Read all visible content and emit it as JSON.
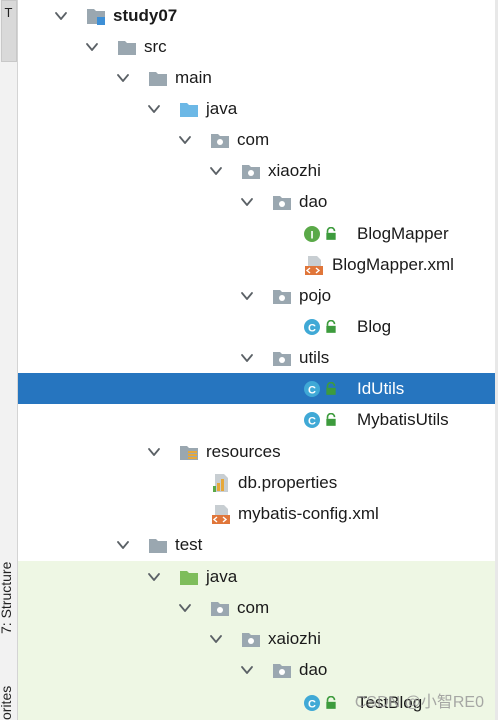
{
  "left_tabs": {
    "top_tab_label": "T",
    "structure_tab_label": "7: Structure",
    "favorites_tab_label": "orites"
  },
  "tree": {
    "project": "study07",
    "src": "src",
    "main": "main",
    "main_java": "java",
    "main_com": "com",
    "main_pkg": "xiaozhi",
    "dao": "dao",
    "blog_mapper": "BlogMapper",
    "blog_mapper_xml": "BlogMapper.xml",
    "pojo": "pojo",
    "blog": "Blog",
    "utils": "utils",
    "id_utils": "IdUtils",
    "mybatis_utils": "MybatisUtils",
    "resources": "resources",
    "db_properties": "db.properties",
    "mybatis_config": "mybatis-config.xml",
    "test": "test",
    "test_java": "java",
    "test_com": "com",
    "test_pkg": "xaiozhi",
    "test_dao": "dao",
    "test_blog": "TestBlog"
  },
  "selected_item": "IdUtils",
  "watermark": "CSDN @小智RE0",
  "colors": {
    "selection": "#2675bf",
    "test_background": "#eef7e4",
    "folder": "#9aa7b0",
    "source_folder": "#6cb8e6",
    "test_folder": "#7ebd5b",
    "class_icon": "#40a9d6",
    "interface_icon": "#5aa948",
    "xml_icon": "#e0763a"
  }
}
